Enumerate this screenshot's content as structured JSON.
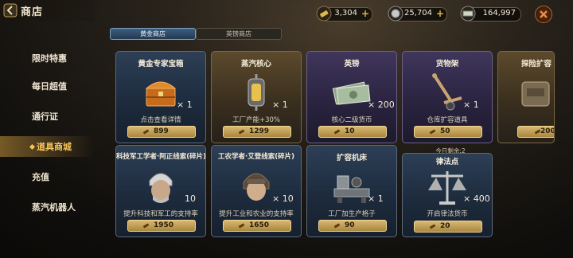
{
  "header": {
    "title": "商店"
  },
  "currencies": [
    {
      "icon": "gold-bar-icon",
      "value": "3,304"
    },
    {
      "icon": "silver-coin-icon",
      "value": "25,704"
    },
    {
      "icon": "cash-icon",
      "value": "164,997"
    }
  ],
  "sidebar": {
    "items": [
      {
        "label": "限时特惠",
        "active": false
      },
      {
        "label": "每日超值",
        "active": false
      },
      {
        "label": "通行证",
        "active": false
      },
      {
        "label": "道具商城",
        "active": true
      },
      {
        "label": "充值",
        "active": false
      },
      {
        "label": "蒸汽机器人",
        "active": false
      }
    ]
  },
  "tabs": [
    {
      "label": "黄金商店",
      "active": true
    },
    {
      "label": "英镑商店",
      "active": false
    }
  ],
  "remaining_label": "今日剩余:2",
  "cards": [
    {
      "name": "黄金专家宝箱",
      "qty": "× 1",
      "desc": "点击查看详情",
      "price": "899",
      "icon": "treasure-chest-icon"
    },
    {
      "name": "蒸汽核心",
      "qty": "× 1",
      "desc": "工厂产能+30%",
      "price": "1299",
      "icon": "steam-core-icon"
    },
    {
      "name": "英镑",
      "qty": "× 200",
      "desc": "核心二级货币",
      "price": "10",
      "icon": "pound-notes-icon"
    },
    {
      "name": "货物架",
      "qty": "× 1",
      "desc": "仓库扩容道具",
      "price": "50",
      "icon": "hand-truck-icon"
    },
    {
      "name": "探险扩容",
      "qty": "",
      "desc": "",
      "price": "200",
      "icon": "backpack-icon"
    },
    {
      "name": "科技军工学者·阿正线索(碎片)",
      "qty": "10",
      "desc": "提升科技和军工的支持率",
      "price": "1950",
      "icon": "scholar-portrait-icon"
    },
    {
      "name": "工农学者·艾登线索(碎片)",
      "qty": "× 10",
      "desc": "提升工业和农业的支持率",
      "price": "1650",
      "icon": "aviator-portrait-icon"
    },
    {
      "name": "扩容机床",
      "qty": "× 1",
      "desc": "工厂加生产格子",
      "price": "90",
      "icon": "lathe-machine-icon"
    },
    {
      "name": "律法点",
      "qty": "× 400",
      "desc": "开启律法货币",
      "price": "20",
      "icon": "scales-icon"
    }
  ]
}
